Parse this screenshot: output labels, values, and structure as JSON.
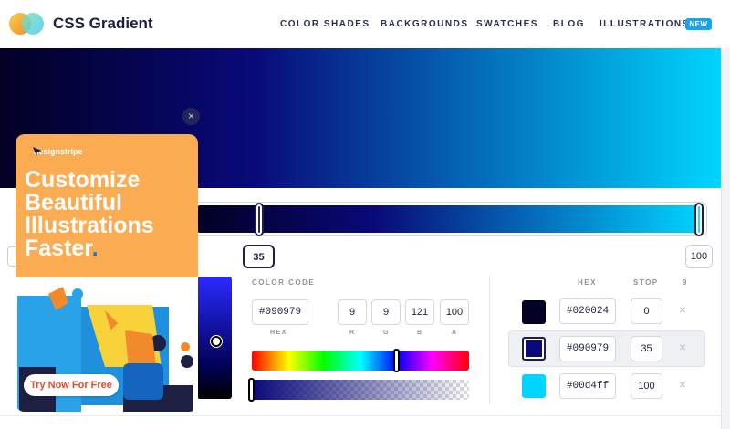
{
  "header": {
    "brand": "CSS Gradient",
    "nav": [
      {
        "label": "COLOR SHADES"
      },
      {
        "label": "BACKGROUNDS"
      },
      {
        "label": "SWATCHES"
      },
      {
        "label": "BLOG"
      },
      {
        "label": "ILLUSTRATIONS"
      }
    ],
    "badge": "NEW"
  },
  "gradient": {
    "stops": [
      {
        "hex": "#020024",
        "stop": "0"
      },
      {
        "hex": "#090979",
        "stop": "35"
      },
      {
        "hex": "#00d4ff",
        "stop": "100"
      }
    ],
    "selected_stop": 1,
    "handle_positions": [
      "35",
      "100"
    ]
  },
  "color_code": {
    "title": "COLOR CODE",
    "hex": "#090979",
    "r": "9",
    "g": "9",
    "b": "121",
    "a": "100",
    "labels": {
      "hex": "HEX",
      "r": "R",
      "g": "G",
      "b": "B",
      "a": "A"
    },
    "hue_level": 0.67,
    "alpha_level": 0.0
  },
  "stops_panel": {
    "col_hex": "HEX",
    "col_stop": "STOP",
    "col_delete": "9",
    "delete_icon": "×"
  },
  "ad": {
    "brand": "designstripe",
    "headline": [
      "Customize",
      "Beautiful",
      "Illustrations",
      "Faster"
    ],
    "headline_dot": ".",
    "cta": "Try Now For Free",
    "close": "×",
    "colors": {
      "background": "#fbab52",
      "accent": "#1a73c9"
    }
  },
  "colors": {
    "brand_text": "#1d2043",
    "badge": "#18a3f0"
  }
}
